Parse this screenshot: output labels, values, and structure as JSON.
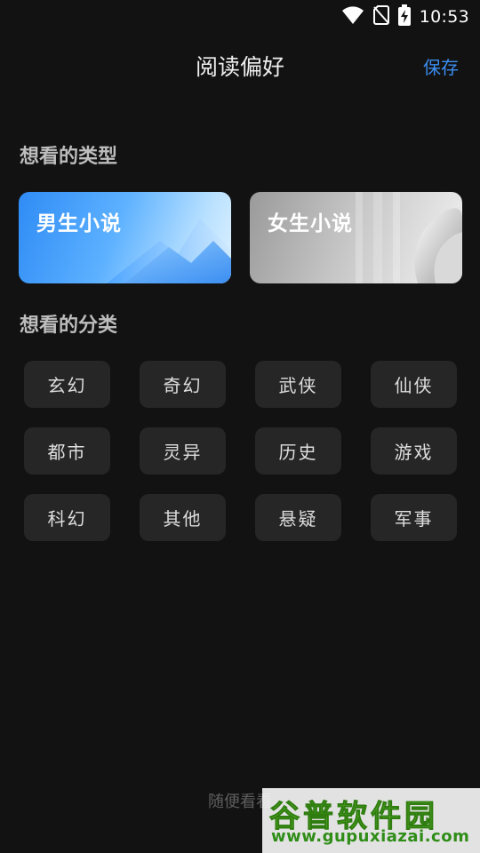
{
  "status_bar": {
    "time": "10:53",
    "icons": [
      "wifi-icon",
      "no-sim-icon",
      "battery-charging-icon"
    ]
  },
  "header": {
    "title": "阅读偏好",
    "save_label": "保存"
  },
  "type_section": {
    "title": "想看的类型",
    "cards": [
      {
        "label": "男生小说",
        "accent": "#2f8cf5"
      },
      {
        "label": "女生小说",
        "accent": "#c5c5c5"
      }
    ]
  },
  "category_section": {
    "title": "想看的分类",
    "chips": [
      "玄幻",
      "奇幻",
      "武侠",
      "仙侠",
      "都市",
      "灵异",
      "历史",
      "游戏",
      "科幻",
      "其他",
      "悬疑",
      "军事"
    ]
  },
  "footer": {
    "random_label": "随便看看"
  },
  "watermark": {
    "logo_text": "谷普软件园",
    "url_text": "www.gupuxiazai.com"
  },
  "colors": {
    "background": "#121212",
    "accent_blue": "#3b8df0",
    "chip_bg": "#262626"
  }
}
